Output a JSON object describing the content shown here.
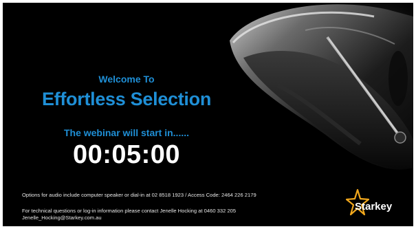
{
  "slide": {
    "welcome": "Welcome To",
    "title": "Effortless Selection",
    "subtitle": "The webinar will start in......",
    "countdown": "00:05:00"
  },
  "footer": {
    "audio_line": "Options for audio include computer speaker or dial-in at 02 8518 1923 /  Access Code: 2464 226 2179",
    "contact_line": "For technical questions or log-in information please contact Jenelle Hocking at 0460 332 205",
    "email_line": "Jenelle_Hocking@Starkey.com.au"
  },
  "brand": {
    "name": "Starkey",
    "accent_color": "#1f8fd6",
    "star_color": "#f2a81d"
  }
}
